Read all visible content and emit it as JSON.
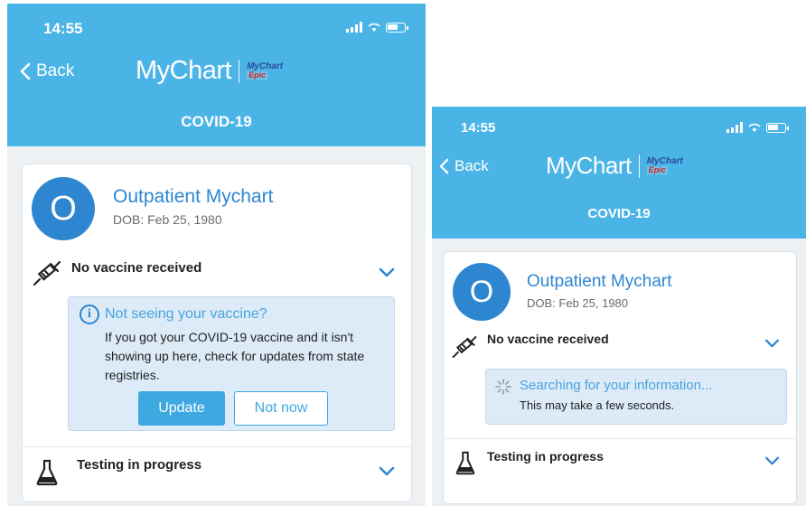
{
  "screens": [
    {
      "status": {
        "time": "14:55"
      },
      "header": {
        "back_label": "Back",
        "logo_text": "MyChart",
        "badge_top": "MyChart",
        "badge_bottom": "Epic",
        "title": "COVID-19"
      },
      "patient": {
        "initial": "O",
        "name": "Outpatient Mychart",
        "dob": "DOB: Feb 25, 1980"
      },
      "vaccine": {
        "label": "No vaccine received",
        "notice_title": "Not seeing your vaccine?",
        "notice_text": "If you got your COVID-19 vaccine and it isn't showing up here, check for updates from state registries.",
        "update_label": "Update",
        "not_now_label": "Not now"
      },
      "testing": {
        "label": "Testing in progress"
      }
    },
    {
      "status": {
        "time": "14:55"
      },
      "header": {
        "back_label": "Back",
        "logo_text": "MyChart",
        "badge_top": "MyChart",
        "badge_bottom": "Epic",
        "title": "COVID-19"
      },
      "patient": {
        "initial": "O",
        "name": "Outpatient Mychart",
        "dob": "DOB: Feb 25, 1980"
      },
      "vaccine": {
        "label": "No vaccine received",
        "searching_title": "Searching for your information...",
        "searching_sub": "This may take a few seconds."
      },
      "testing": {
        "label": "Testing in progress"
      }
    }
  ],
  "colors": {
    "header": "#4bb4e6",
    "accent": "#2e86d1",
    "notice_bg": "#dcebf7",
    "button": "#3da9e0"
  },
  "icons": [
    "back-chevron-icon",
    "signal-icon",
    "wifi-icon",
    "battery-icon",
    "syringe-icon",
    "info-icon",
    "spinner-icon",
    "flask-icon",
    "chevron-down-icon"
  ]
}
